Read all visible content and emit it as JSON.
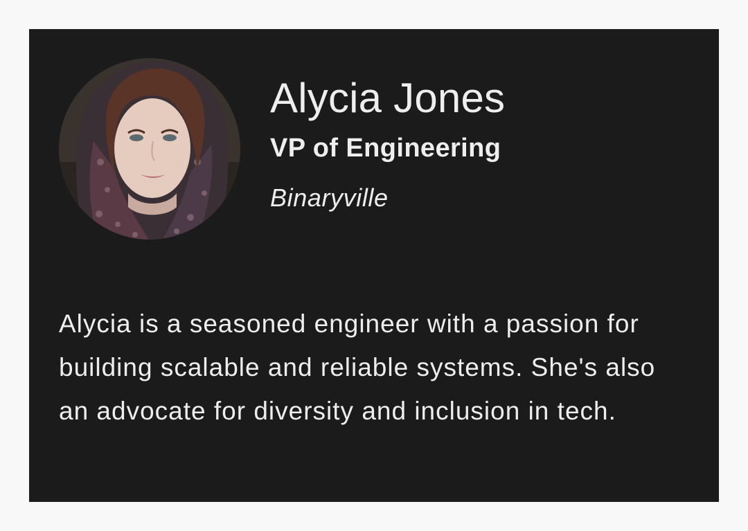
{
  "profile": {
    "avatar_icon": "person-photo",
    "name": "Alycia Jones",
    "title": "VP of Engineering",
    "company": "Binaryville",
    "bio": "Alycia is a seasoned engineer with a passion for building scalable and reliable systems. She's also an advocate for diversity and inclusion in tech."
  },
  "colors": {
    "page_background": "#f8f8f8",
    "card_background": "#1b1b1b",
    "text": "#eeeeee"
  }
}
